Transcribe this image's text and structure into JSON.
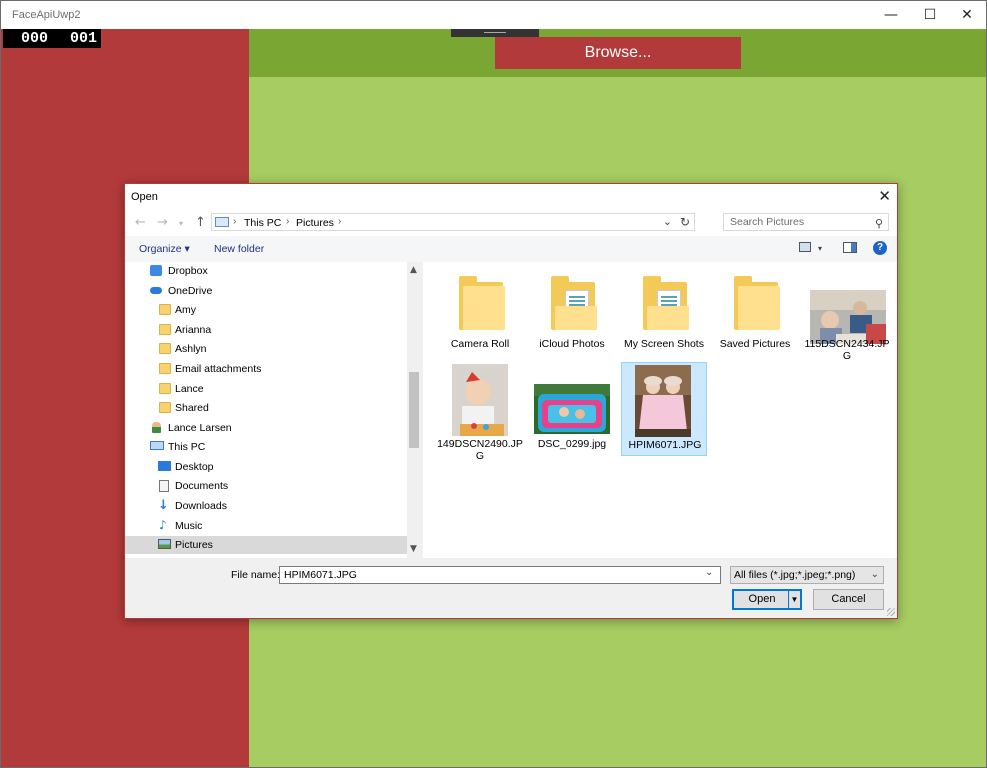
{
  "app": {
    "title": "FaceApiUwp2",
    "counter_left": "000",
    "counter_right": "001",
    "browse_label": "Browse..."
  },
  "window_controls": {
    "minimize": "—",
    "maximize": "☐",
    "close": "✕"
  },
  "dialog": {
    "title": "Open",
    "close": "✕",
    "breadcrumb": [
      "This PC",
      "Pictures"
    ],
    "search_placeholder": "Search Pictures",
    "organize_label": "Organize ▾",
    "new_folder_label": "New folder",
    "help_label": "?",
    "tree": [
      {
        "label": "Dropbox",
        "icon": "dropbox-icon"
      },
      {
        "label": "OneDrive",
        "icon": "cloud-icon"
      },
      {
        "label": "Amy",
        "icon": "folder-icon"
      },
      {
        "label": "Arianna",
        "icon": "folder-icon"
      },
      {
        "label": "Ashlyn",
        "icon": "folder-icon"
      },
      {
        "label": "Email attachments",
        "icon": "folder-icon"
      },
      {
        "label": "Lance",
        "icon": "folder-icon"
      },
      {
        "label": "Shared",
        "icon": "folder-icon"
      },
      {
        "label": "Lance Larsen",
        "icon": "user-icon"
      },
      {
        "label": "This PC",
        "icon": "computer-icon"
      },
      {
        "label": "Desktop",
        "icon": "desktop-icon"
      },
      {
        "label": "Documents",
        "icon": "documents-icon"
      },
      {
        "label": "Downloads",
        "icon": "download-icon"
      },
      {
        "label": "Music",
        "icon": "music-icon"
      },
      {
        "label": "Pictures",
        "icon": "pictures-icon"
      }
    ],
    "files": [
      {
        "label": "Camera Roll",
        "kind": "folder"
      },
      {
        "label": "iCloud Photos",
        "kind": "folder-docs"
      },
      {
        "label": "My Screen Shots",
        "kind": "folder-docs"
      },
      {
        "label": "Saved Pictures",
        "kind": "folder"
      },
      {
        "label": "115DSCN2434.JPG",
        "kind": "photo"
      },
      {
        "label": "149DSCN2490.JPG",
        "kind": "photo"
      },
      {
        "label": "DSC_0299.jpg",
        "kind": "photo"
      },
      {
        "label": "HPIM6071.JPG",
        "kind": "photo",
        "selected": true
      }
    ],
    "file_name_label": "File name:",
    "file_name_value": "HPIM6071.JPG",
    "filter_value": "All files (*.jpg;*.jpeg;*.png)",
    "open_label": "Open",
    "cancel_label": "Cancel"
  },
  "colors": {
    "accent_red": "#b33a3a",
    "green_dark": "#7aa634",
    "green_light": "#a6cc62",
    "selection": "#cce8ff"
  }
}
